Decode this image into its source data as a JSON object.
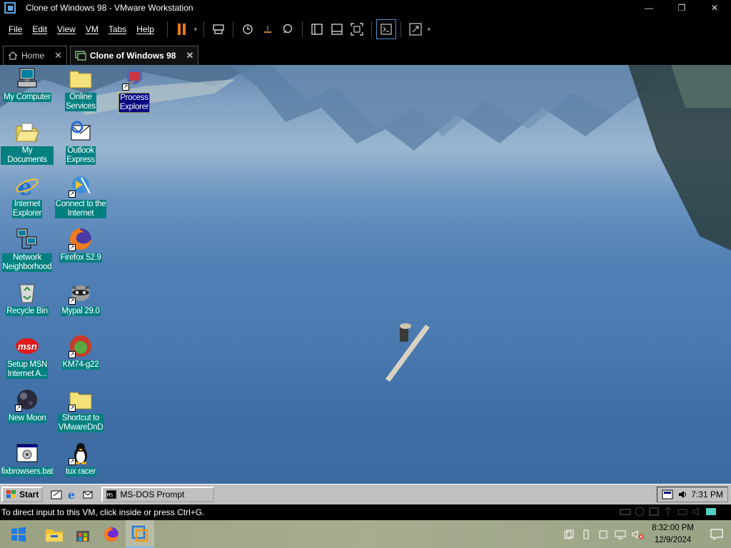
{
  "window": {
    "title": "Clone of Windows 98 - VMware Workstation",
    "controls": {
      "minimize": "—",
      "restore": "❐",
      "close": "✕"
    }
  },
  "menu": [
    "File",
    "Edit",
    "View",
    "VM",
    "Tabs",
    "Help"
  ],
  "toolbar_icons": [
    "pause-icon",
    "send-ctrl-alt-del-icon",
    "snapshot-icon",
    "revert-snapshot-icon",
    "snapshot-manager-icon",
    "show-library-icon",
    "thumbnail-bar-icon",
    "full-screen-icon",
    "console-view-icon",
    "stretch-guest-icon"
  ],
  "tabs": [
    {
      "label": "Home",
      "active": false,
      "close": "✕"
    },
    {
      "label": "Clone of Windows 98",
      "active": true,
      "close": "✕"
    }
  ],
  "desktop_icons": [
    {
      "id": "my-computer",
      "label": "My Computer",
      "icon": "computer-icon",
      "shortcut": false,
      "selected": false
    },
    {
      "id": "online-services",
      "label": "Online\nServices",
      "icon": "folder-icon",
      "shortcut": false,
      "selected": false
    },
    {
      "id": "process-explorer",
      "label": "Process\nExplorer",
      "icon": "process-explorer-icon",
      "shortcut": true,
      "selected": true
    },
    {
      "id": "my-documents",
      "label": "My Documents",
      "icon": "open-folder-icon",
      "shortcut": false,
      "selected": false
    },
    {
      "id": "outlook-express",
      "label": "Outlook\nExpress",
      "icon": "outlook-express-icon",
      "shortcut": false,
      "selected": false
    },
    {
      "id": "internet-explorer",
      "label": "Internet\nExplorer",
      "icon": "internet-explorer-icon",
      "shortcut": false,
      "selected": false
    },
    {
      "id": "connect-to-internet",
      "label": "Connect to the\nInternet",
      "icon": "connect-internet-icon",
      "shortcut": true,
      "selected": false
    },
    {
      "id": "network-neighborhood",
      "label": "Network\nNeighborhood",
      "icon": "network-icon",
      "shortcut": false,
      "selected": false
    },
    {
      "id": "firefox",
      "label": "Firefox 52.9",
      "icon": "firefox-icon",
      "shortcut": true,
      "selected": false
    },
    {
      "id": "recycle-bin",
      "label": "Recycle Bin",
      "icon": "recycle-bin-icon",
      "shortcut": false,
      "selected": false
    },
    {
      "id": "mypal",
      "label": "Mypal 29.0",
      "icon": "mypal-icon",
      "shortcut": true,
      "selected": false
    },
    {
      "id": "setup-msn",
      "label": "Setup MSN\nInternet A...",
      "icon": "msn-icon",
      "shortcut": false,
      "selected": false
    },
    {
      "id": "km74",
      "label": "KM74-g22",
      "icon": "km74-icon",
      "shortcut": true,
      "selected": false
    },
    {
      "id": "new-moon",
      "label": "New Moon",
      "icon": "new-moon-icon",
      "shortcut": true,
      "selected": false
    },
    {
      "id": "vmware-dnd",
      "label": "Shortcut to\nVMwareDnD",
      "icon": "folder-icon",
      "shortcut": true,
      "selected": false
    },
    {
      "id": "fixbrowsers",
      "label": "fixbrowsers.bat",
      "icon": "batch-file-icon",
      "shortcut": false,
      "selected": false
    },
    {
      "id": "tux-racer",
      "label": "tux racer",
      "icon": "tux-icon",
      "shortcut": true,
      "selected": false
    }
  ],
  "guest_taskbar": {
    "start_label": "Start",
    "quick_launch": [
      "show-desktop-icon",
      "internet-explorer-icon",
      "outlook-express-icon"
    ],
    "task_label": "MS-DOS Prompt",
    "clock": "7:31 PM"
  },
  "status_bar": {
    "message": "To direct input to this VM, click inside or press Ctrl+G."
  },
  "host_taskbar": {
    "apps": [
      "windows-start-icon",
      "file-explorer-icon",
      "microsoft-store-icon",
      "firefox-icon",
      "vmware-workstation-icon"
    ],
    "time": "8:32:00 PM",
    "date": "12/9/2024"
  },
  "colors": {
    "desktop_label_bg": "#008080",
    "selection_bg": "#000080",
    "win98_gray": "#c0c0c0",
    "host_taskbar": "#a3a98b"
  }
}
